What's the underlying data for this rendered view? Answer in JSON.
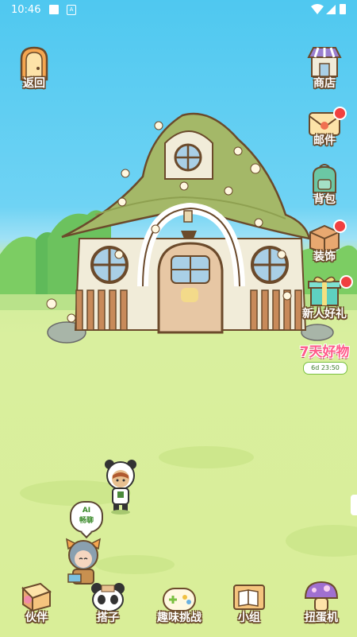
{
  "status_bar": {
    "time": "10:46",
    "a_icon": "A",
    "icons": [
      "square-icon",
      "a-icon",
      "wifi-icon",
      "signal-icon",
      "battery-icon"
    ]
  },
  "top_left": {
    "back_label": "返回"
  },
  "right_menu": [
    {
      "label": "商店",
      "icon": "shop-icon",
      "badge": false
    },
    {
      "label": "邮件",
      "icon": "mail-icon",
      "badge": true
    },
    {
      "label": "背包",
      "icon": "backpack-icon",
      "badge": false
    },
    {
      "label": "装饰",
      "icon": "decoration-box-icon",
      "badge": true
    },
    {
      "label": "新人好礼",
      "icon": "gift-icon",
      "badge": true
    }
  ],
  "promo": {
    "title": "7天好物",
    "timer": "6d 23:50"
  },
  "chat_bubble": {
    "line1": "AI",
    "line2": "畅聊"
  },
  "bottom_nav": [
    {
      "label": "伙伴",
      "icon": "partner-book-icon"
    },
    {
      "label": "搭子",
      "icon": "panda-icon"
    },
    {
      "label": "趣味挑战",
      "icon": "gamepad-icon"
    },
    {
      "label": "小组",
      "icon": "book-board-icon"
    },
    {
      "label": "扭蛋机",
      "icon": "gacha-mushroom-icon"
    }
  ],
  "colors": {
    "sky": "#4fc8f0",
    "grass": "#d9ef9e",
    "roof": "#a4b868",
    "wall": "#f1ecd9",
    "door": "#e7c7a4",
    "outline": "#6b4a2b",
    "badge": "#f04040"
  }
}
